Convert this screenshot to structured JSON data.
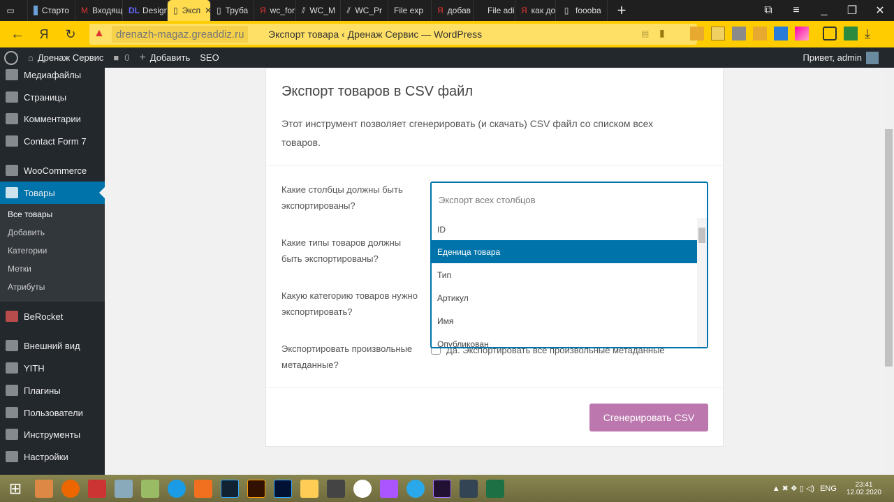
{
  "browser": {
    "tabs": [
      "Старто",
      "Входящ",
      "Design",
      "Эксп",
      "Труба",
      "wc_for",
      "WC_M",
      "WC_Pr",
      "File exp",
      "добав",
      "File adi",
      "как до",
      "foooba"
    ],
    "url": "drenazh-magaz.greaddiz.ru",
    "title": "Экспорт товара ‹ Дренаж Сервис — WordPress"
  },
  "adminbar": {
    "site": "Дренаж Сервис",
    "comments": "0",
    "add": "Добавить",
    "seo": "SEO",
    "greeting": "Привет, admin"
  },
  "sidebar": {
    "items": [
      "Медиафайлы",
      "Страницы",
      "Комментарии",
      "Contact Form 7",
      "WooCommerce",
      "Товары",
      "BeRocket",
      "Внешний вид",
      "YITH",
      "Плагины",
      "Пользователи",
      "Инструменты",
      "Настройки"
    ],
    "sub": [
      "Все товары",
      "Добавить",
      "Категории",
      "Метки",
      "Атрибуты"
    ]
  },
  "card": {
    "title": "Экспорт товаров в CSV файл",
    "description": "Этот инструмент позволяет сгенерировать (и скачать) CSV файл со списком всех товаров.",
    "labels": [
      "Какие столбцы должны быть экспортированы?",
      "Какие типы товаров должны быть экспортированы?",
      "Какую категорию товаров нужно экспортировать?",
      "Экспортировать произвольные метаданные?"
    ],
    "select_placeholder": "Экспорт всех столбцов",
    "options": [
      "ID",
      "Еденица товара",
      "Тип",
      "Артикул",
      "Имя",
      "Опубликован"
    ],
    "checkbox_label": "Да. Экспортировать все произвольные метаданные",
    "button": "Сгенерировать CSV"
  },
  "taskbar": {
    "lang": "ENG",
    "time": "23:41",
    "date": "12.02.2020"
  }
}
